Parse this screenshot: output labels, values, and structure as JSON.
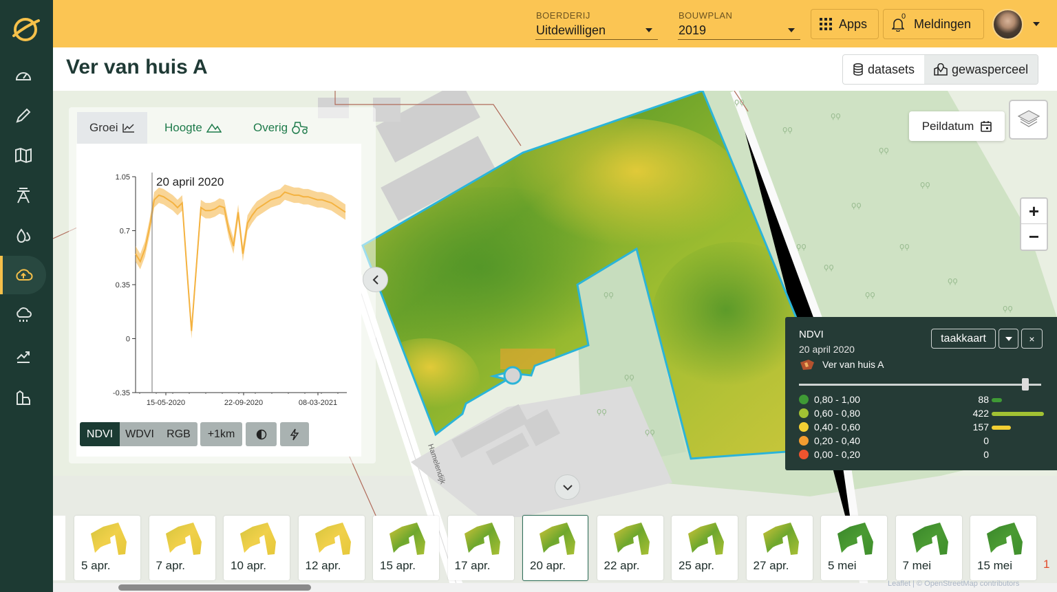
{
  "topbar": {
    "farm_label": "BOERDERIJ",
    "farm_value": "Uitdewilligen",
    "plan_label": "BOUWPLAN",
    "plan_value": "2019",
    "apps_label": "Apps",
    "notif_label": "Meldingen",
    "notif_count": "0"
  },
  "header": {
    "title": "Ver van huis A",
    "datasets_label": "datasets",
    "parcel_label": "gewasperceel"
  },
  "sidebar": {
    "items": [
      {
        "icon": "gauge-icon"
      },
      {
        "icon": "pencil-icon"
      },
      {
        "icon": "map-icon"
      },
      {
        "icon": "tower-icon"
      },
      {
        "icon": "drops-icon"
      },
      {
        "icon": "cloud-upload-icon",
        "active": true
      },
      {
        "icon": "rain-cloud-icon"
      },
      {
        "icon": "trend-icon"
      },
      {
        "icon": "farm-icon"
      }
    ]
  },
  "chart_panel": {
    "tabs": [
      "Groei",
      "Hoogte",
      "Overig"
    ],
    "active_tab": "Groei",
    "buttons": [
      "NDVI",
      "WDVI",
      "RGB",
      "+1km"
    ],
    "active_button": "NDVI"
  },
  "chart_data": {
    "type": "line",
    "annotation": "20 april 2020",
    "yticks": [
      "1.05",
      "0.7",
      "0.35",
      "0",
      "-0.35"
    ],
    "xticks": [
      "15-05-2020",
      "22-09-2020",
      "08-03-2021"
    ],
    "ylim": [
      -0.35,
      1.05
    ],
    "series": [
      {
        "values": [
          0.55,
          0.5,
          0.58,
          0.72,
          0.9,
          0.93,
          0.92,
          0.9,
          0.88,
          0.85,
          0.88,
          0.45,
          0.05,
          0.45,
          0.85,
          0.83,
          0.83,
          0.84,
          0.86,
          0.85,
          0.7,
          0.6,
          0.82,
          0.55,
          0.75,
          0.8,
          0.84,
          0.86,
          0.88,
          0.9,
          0.91,
          0.92,
          0.95,
          0.94,
          0.93,
          0.93,
          0.92,
          0.92,
          0.91,
          0.9,
          0.9,
          0.89,
          0.88,
          0.86,
          0.84,
          0.82
        ],
        "band": 0.05,
        "color": "#f4b240"
      }
    ]
  },
  "map": {
    "peildatum_label": "Peildatum",
    "zoom_in": "+",
    "zoom_out": "−",
    "street_label": "Hamelendijk",
    "attribution": "Leaflet | © OpenStreetMap contributors"
  },
  "legend": {
    "title": "NDVI",
    "date": "20 april 2020",
    "field": "Ver van huis A",
    "taakkaart_label": "taakkaart",
    "close_label": "×",
    "classes": [
      {
        "range": "0,80 - 1,00",
        "count": "88",
        "color": "#3f9a35",
        "fill": 0.2
      },
      {
        "range": "0,60 - 0,80",
        "count": "422",
        "color": "#a2c233",
        "fill": 1.0
      },
      {
        "range": "0,40 - 0,60",
        "count": "157",
        "color": "#f3cf33",
        "fill": 0.37
      },
      {
        "range": "0,20 - 0,40",
        "count": "0",
        "color": "#f39c30",
        "fill": 0
      },
      {
        "range": "0,00 - 0,20",
        "count": "0",
        "color": "#f0542e",
        "fill": 0
      }
    ]
  },
  "timeline": {
    "items": [
      {
        "label": "5 apr.",
        "tone": "yellow"
      },
      {
        "label": "7 apr.",
        "tone": "yellow"
      },
      {
        "label": "10 apr.",
        "tone": "yellow"
      },
      {
        "label": "12 apr.",
        "tone": "yellow"
      },
      {
        "label": "15 apr.",
        "tone": "mixed"
      },
      {
        "label": "17 apr.",
        "tone": "mixed"
      },
      {
        "label": "20 apr.",
        "tone": "mixed",
        "selected": true
      },
      {
        "label": "22 apr.",
        "tone": "mixed"
      },
      {
        "label": "25 apr.",
        "tone": "mixed"
      },
      {
        "label": "27 apr.",
        "tone": "mixed"
      },
      {
        "label": "5 mei",
        "tone": "green"
      },
      {
        "label": "7 mei",
        "tone": "green"
      },
      {
        "label": "15 mei",
        "tone": "green"
      }
    ]
  }
}
